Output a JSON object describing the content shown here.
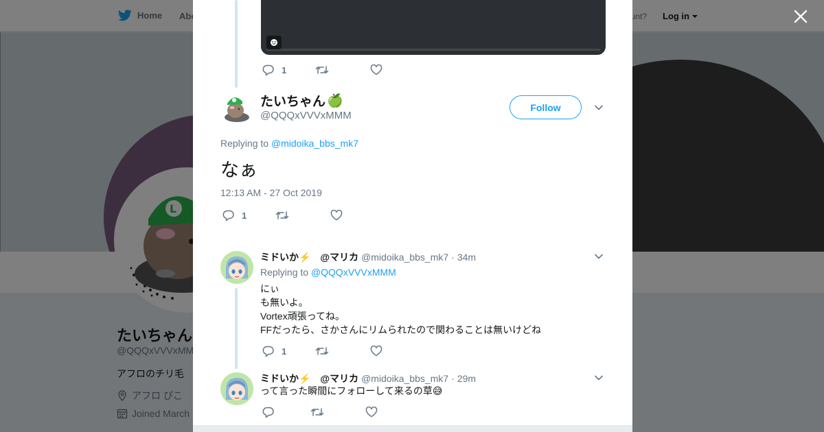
{
  "topbar": {
    "home": "Home",
    "about": "Abo",
    "account_prompt": "ccount?",
    "login": "Log in"
  },
  "profile": {
    "name": "たいちゃん",
    "handle": "@QQQxVVVxMM",
    "bio": "アフロのチリ毛",
    "location": "アフロ ぴこ",
    "joined": "Joined March"
  },
  "modal": {
    "prev_tweet": {
      "reply_count": "1"
    },
    "main_tweet": {
      "name": "たいちゃん",
      "name_emoji": "🍏",
      "handle": "@QQQxVVVxMMM",
      "follow_label": "Follow",
      "replying_prefix": "Replying to",
      "replying_to": "@midoika_bbs_mk7",
      "text": "なぁ",
      "timestamp": "12:13 AM - 27 Oct 2019",
      "reply_count": "1"
    },
    "replies": [
      {
        "name": "ミドいか⚡️　@マリカ",
        "handle": "@midoika_bbs_mk7",
        "dot": "·",
        "time": "34m",
        "replying_prefix": "Replying to",
        "replying_to": "@QQQxVVVxMMM",
        "lines": [
          "にぃ",
          "も無いよ。",
          "Vortex頑張ってね。",
          "FFだったら、さかさんにリムられたので関わることは無いけどね"
        ],
        "reply_count": "1"
      },
      {
        "name": "ミドいか⚡️　@マリカ",
        "handle": "@midoika_bbs_mk7",
        "dot": "·",
        "time": "29m",
        "text": "って言った瞬間にフォローして来るの草😅",
        "reply_count": ""
      }
    ]
  },
  "colors": {
    "accent": "#1da1f2",
    "muted": "#657786",
    "thread_line": "#cce5f6"
  },
  "icons": [
    "twitter-bird-icon",
    "close-icon",
    "reply-icon",
    "retweet-icon",
    "like-icon",
    "chevron-down-icon",
    "location-icon",
    "calendar-icon",
    "caption-icon"
  ]
}
